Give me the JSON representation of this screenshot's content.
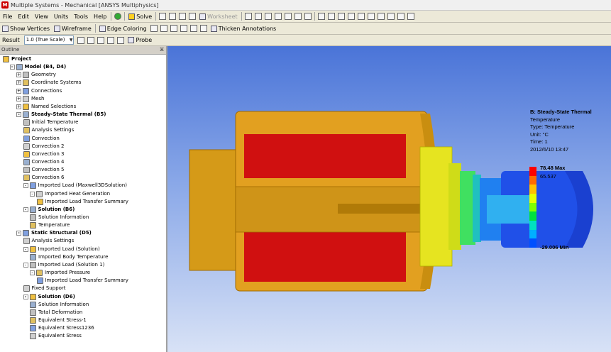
{
  "window": {
    "title": "Multiple Systems - Mechanical [ANSYS Multiphysics]",
    "app_icon_letter": "M"
  },
  "menu": [
    "File",
    "Edit",
    "View",
    "Units",
    "Tools",
    "Help"
  ],
  "toolbar1": {
    "solve": "Solve",
    "worksheet": "Worksheet"
  },
  "toolbar2": {
    "show_vertices": "Show Vertices",
    "wireframe": "Wireframe",
    "edge_coloring": "Edge Coloring",
    "thicken_annotations": "Thicken Annotations"
  },
  "toolbar3": {
    "result_label": "Result",
    "scale_value": "1.0 (True Scale)",
    "probe": "Probe"
  },
  "outline": {
    "header": "Outline",
    "pin": "ⴼ",
    "nodes": [
      {
        "label": "Project",
        "depth": 0,
        "bold": true,
        "exp": ""
      },
      {
        "label": "Model (B4, D4)",
        "depth": 1,
        "bold": true,
        "exp": "-"
      },
      {
        "label": "Geometry",
        "depth": 2,
        "bold": false,
        "exp": "+"
      },
      {
        "label": "Coordinate Systems",
        "depth": 2,
        "bold": false,
        "exp": "+"
      },
      {
        "label": "Connections",
        "depth": 2,
        "bold": false,
        "exp": "+"
      },
      {
        "label": "Mesh",
        "depth": 2,
        "bold": false,
        "exp": "+"
      },
      {
        "label": "Named Selections",
        "depth": 2,
        "bold": false,
        "exp": "+"
      },
      {
        "label": "Steady-State Thermal (B5)",
        "depth": 2,
        "bold": true,
        "exp": "-"
      },
      {
        "label": "Initial Temperature",
        "depth": 3,
        "bold": false,
        "exp": ""
      },
      {
        "label": "Analysis Settings",
        "depth": 3,
        "bold": false,
        "exp": ""
      },
      {
        "label": "Convection",
        "depth": 3,
        "bold": false,
        "exp": ""
      },
      {
        "label": "Convection 2",
        "depth": 3,
        "bold": false,
        "exp": ""
      },
      {
        "label": "Convection 3",
        "depth": 3,
        "bold": false,
        "exp": ""
      },
      {
        "label": "Convection 4",
        "depth": 3,
        "bold": false,
        "exp": ""
      },
      {
        "label": "Convection 5",
        "depth": 3,
        "bold": false,
        "exp": ""
      },
      {
        "label": "Convection 6",
        "depth": 3,
        "bold": false,
        "exp": ""
      },
      {
        "label": "Imported Load (Maxwell3DSolution)",
        "depth": 3,
        "bold": false,
        "exp": "-"
      },
      {
        "label": "Imported Heat Generation",
        "depth": 4,
        "bold": false,
        "exp": "-"
      },
      {
        "label": "Imported Load Transfer Summary",
        "depth": 5,
        "bold": false,
        "exp": ""
      },
      {
        "label": "Solution (B6)",
        "depth": 3,
        "bold": true,
        "exp": "-"
      },
      {
        "label": "Solution Information",
        "depth": 4,
        "bold": false,
        "exp": ""
      },
      {
        "label": "Temperature",
        "depth": 4,
        "bold": false,
        "exp": ""
      },
      {
        "label": "Static Structural (D5)",
        "depth": 2,
        "bold": true,
        "exp": "-"
      },
      {
        "label": "Analysis Settings",
        "depth": 3,
        "bold": false,
        "exp": ""
      },
      {
        "label": "Imported Load (Solution)",
        "depth": 3,
        "bold": false,
        "exp": "-"
      },
      {
        "label": "Imported Body Temperature",
        "depth": 4,
        "bold": false,
        "exp": ""
      },
      {
        "label": "Imported Load (Solution 1)",
        "depth": 3,
        "bold": false,
        "exp": "-"
      },
      {
        "label": "Imported Pressure",
        "depth": 4,
        "bold": false,
        "exp": "-"
      },
      {
        "label": "Imported Load Transfer Summary",
        "depth": 5,
        "bold": false,
        "exp": ""
      },
      {
        "label": "Fixed Support",
        "depth": 3,
        "bold": false,
        "exp": ""
      },
      {
        "label": "Solution (D6)",
        "depth": 3,
        "bold": true,
        "exp": "-"
      },
      {
        "label": "Solution Information",
        "depth": 4,
        "bold": false,
        "exp": ""
      },
      {
        "label": "Total Deformation",
        "depth": 4,
        "bold": false,
        "exp": ""
      },
      {
        "label": "Equivalent Stress-1",
        "depth": 4,
        "bold": false,
        "exp": ""
      },
      {
        "label": "Equivalent Stress1236",
        "depth": 4,
        "bold": false,
        "exp": ""
      },
      {
        "label": "Equivalent Stress",
        "depth": 4,
        "bold": false,
        "exp": ""
      }
    ]
  },
  "legend": {
    "title": "B: Steady-State Thermal",
    "result": "Temperature",
    "type": "Type: Temperature",
    "unit": "Unit: °C",
    "time": "Time: 1",
    "date": "2012/6/10 13:47",
    "max": "78.48 Max",
    "second": "65.537",
    "min": "-29.006 Min",
    "colors": [
      "#ff0000",
      "#ff6a00",
      "#ffc000",
      "#e6ff00",
      "#80ff00",
      "#00e040",
      "#00e0c0",
      "#00b0ff",
      "#0050ff"
    ]
  },
  "model_colors": {
    "housing": "#e2a020",
    "coil": "#d01010",
    "flange": "#e0e020",
    "transition": "#40e080",
    "shaft": "#2060ff"
  }
}
